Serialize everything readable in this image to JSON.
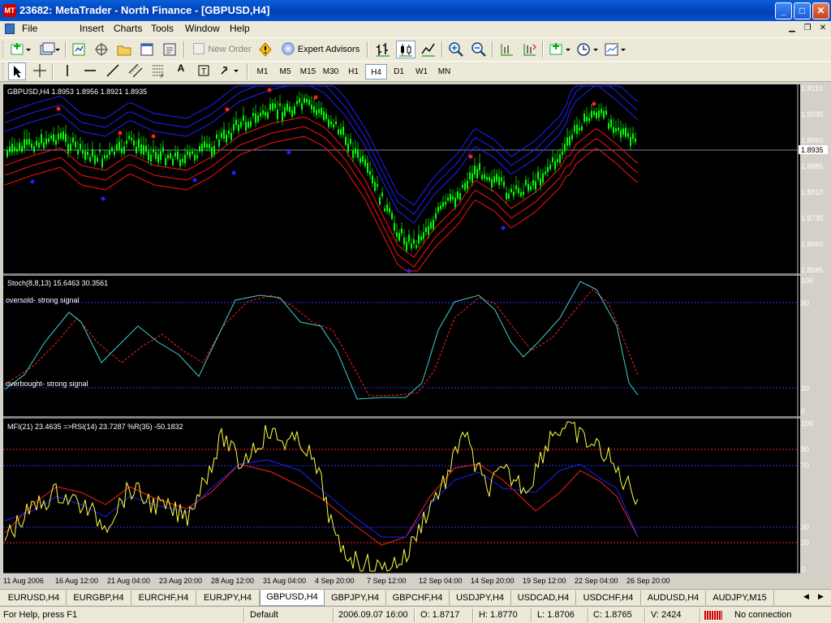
{
  "window": {
    "app_icon_text": "MT",
    "title": "23682: MetaTrader - North Finance - [GBPUSD,H4]"
  },
  "menu": [
    "File",
    "Insert",
    "Charts",
    "Tools",
    "Window",
    "Help"
  ],
  "toolbar": {
    "new_order": "New Order",
    "expert_advisors": "Expert Advisors"
  },
  "timeframes": [
    "M1",
    "M5",
    "M15",
    "M30",
    "H1",
    "H4",
    "D1",
    "W1",
    "MN"
  ],
  "active_timeframe": "H4",
  "main_chart": {
    "label": "GBPUSD,H4 1.8953 1.8956 1.8921 1.8935",
    "price_axis": [
      "1.9110",
      "1.9035",
      "1.8960",
      "1.8885",
      "1.8810",
      "1.8735",
      "1.8660",
      "1.8585"
    ],
    "current_price": "1.8935",
    "colors": {
      "candle_up": "#00ff00",
      "band_upper": "#2020ff",
      "band_lower": "#ff1010",
      "background": "#000000"
    }
  },
  "stoch_panel": {
    "label": "Stoch(8,8,13) 15.6463 30.3561",
    "oversold_note": "oversold-  strong signal",
    "overbought_note": "overbought- strong signal",
    "levels": [
      "100",
      "80",
      "20",
      "0"
    ],
    "colors": {
      "main": "#40d0d0",
      "signal": "#ff2020"
    }
  },
  "mfi_panel": {
    "label": "MFI(21) 23.4635  =>RSI(14) 23.7287  %R(35) -50.1832",
    "levels": [
      "100",
      "80",
      "70",
      "30",
      "20",
      "0"
    ],
    "colors": {
      "mfi": "#ff2020",
      "rsi": "#2020ff",
      "williams": "#ffff40"
    }
  },
  "time_axis": [
    "11 Aug 2006",
    "16 Aug 12:00",
    "21 Aug 04:00",
    "23 Aug 20:00",
    "28 Aug 12:00",
    "31 Aug 04:00",
    "4 Sep 20:00",
    "7 Sep 12:00",
    "12 Sep 04:00",
    "14 Sep 20:00",
    "19 Sep 12:00",
    "22 Sep 04:00",
    "26 Sep 20:00"
  ],
  "symbol_tabs": [
    "EURUSD,H4",
    "EURGBP,H4",
    "EURCHF,H4",
    "EURJPY,H4",
    "GBPUSD,H4",
    "GBPJPY,H4",
    "GBPCHF,H4",
    "USDJPY,H4",
    "USDCAD,H4",
    "USDCHF,H4",
    "AUDUSD,H4",
    "AUDJPY,M15"
  ],
  "active_tab": "GBPUSD,H4",
  "status": {
    "help": "For Help, press F1",
    "profile": "Default",
    "datetime": "2006.09.07 16:00",
    "open": "O: 1.8717",
    "high": "H: 1.8770",
    "low": "L: 1.8706",
    "close": "C: 1.8765",
    "volume": "V: 2424",
    "connection": "No connection"
  }
}
